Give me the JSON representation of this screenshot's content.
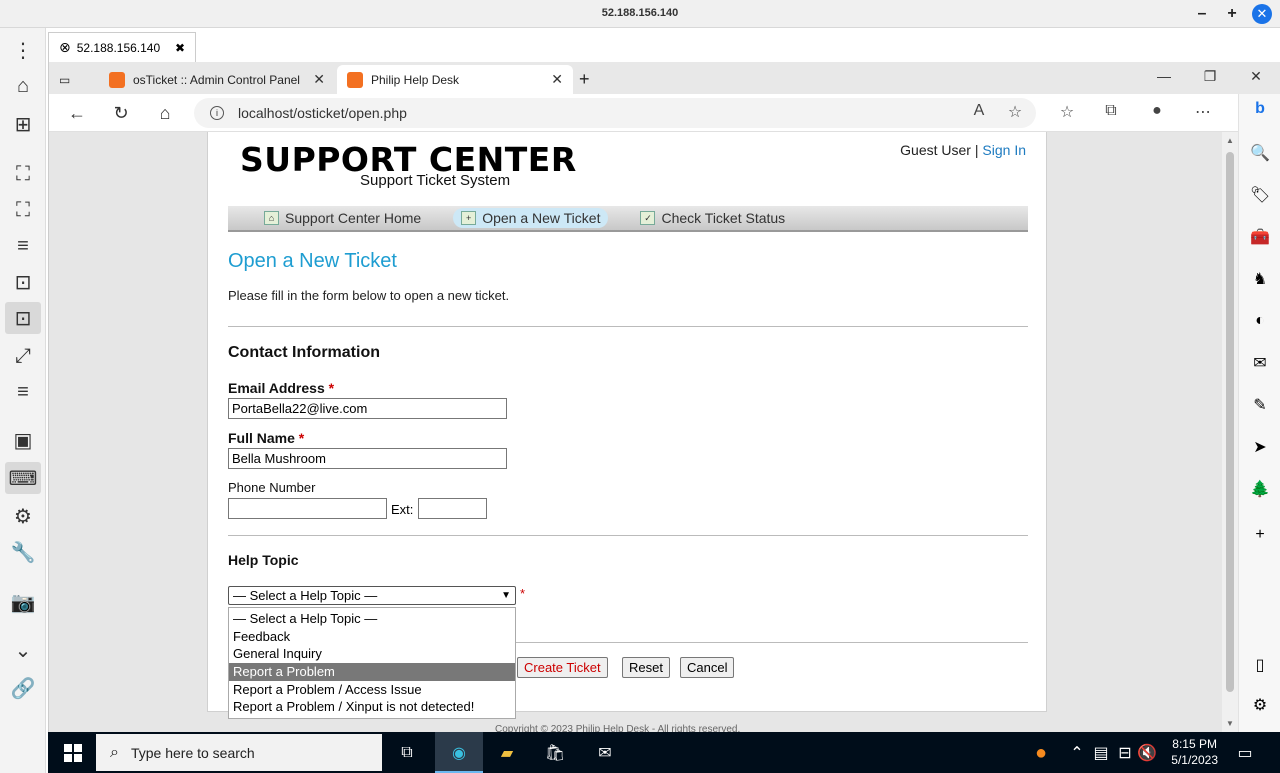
{
  "host": {
    "title": "52.188.156.140"
  },
  "session_tab": {
    "label": "52.188.156.140"
  },
  "browser": {
    "tabs": [
      {
        "label": "osTicket :: Admin Control Panel"
      },
      {
        "label": "Philip Help Desk"
      }
    ],
    "url": "localhost/osticket/open.php"
  },
  "page": {
    "logo_main": "SUPPORT CENTER",
    "logo_sub": "Support Ticket System",
    "guest_user": "Guest User",
    "separator": "|",
    "sign_in": "Sign In",
    "nav": [
      {
        "label": "Support Center Home"
      },
      {
        "label": "Open a New Ticket"
      },
      {
        "label": "Check Ticket Status"
      }
    ],
    "title": "Open a New Ticket",
    "intro": "Please fill in the form below to open a new ticket.",
    "contact_heading": "Contact Information",
    "email_label": "Email Address",
    "email_value": "PortaBella22@live.com",
    "name_label": "Full Name",
    "name_value": "Bella Mushroom",
    "phone_label": "Phone Number",
    "ext_label": "Ext:",
    "required_mark": "*",
    "help_topic_heading": "Help Topic",
    "help_topic_selected": "— Select a Help Topic —",
    "help_topic_options": [
      "— Select a Help Topic —",
      "Feedback",
      "General Inquiry",
      "Report a Problem",
      "Report a Problem / Access Issue",
      "Report a Problem / Xinput is not detected!"
    ],
    "help_topic_highlighted_index": 3,
    "buttons": {
      "create": "Create Ticket",
      "reset": "Reset",
      "cancel": "Cancel"
    },
    "footer": "Copyright © 2023 Philip Help Desk - All rights reserved."
  },
  "taskbar": {
    "search_placeholder": "Type here to search",
    "time": "8:15 PM",
    "date": "5/1/2023"
  }
}
